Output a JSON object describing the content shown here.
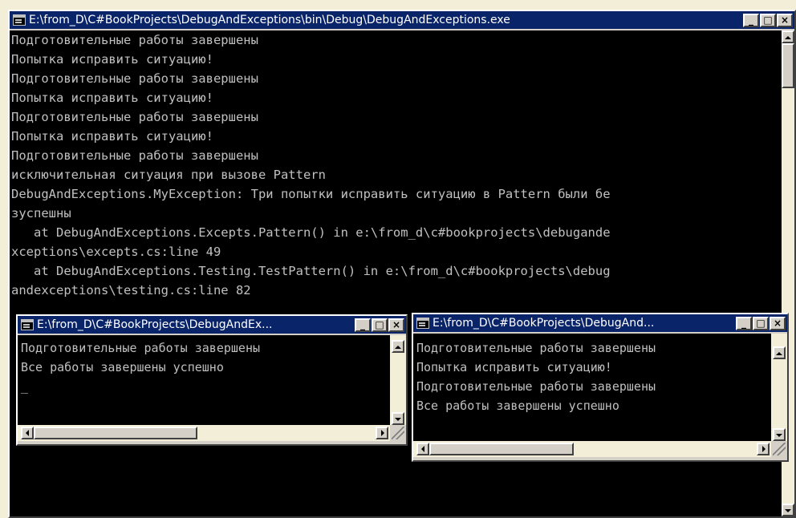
{
  "main_window": {
    "title": "E:\\from_D\\C#BookProjects\\DebugAndExceptions\\bin\\Debug\\DebugAndExceptions.exe",
    "lines": [
      "Подготовительные работы завершены",
      "Попытка исправить ситуацию!",
      "Подготовительные работы завершены",
      "Попытка исправить ситуацию!",
      "Подготовительные работы завершены",
      "Попытка исправить ситуацию!",
      "Подготовительные работы завершены",
      "исключительная ситуация при вызове Pattern",
      "DebugAndExceptions.MyException: Три попытки исправить ситуацию в Pattern были бе",
      "зуспешны",
      "   at DebugAndExceptions.Excepts.Pattern() in e:\\from_d\\c#bookprojects\\debugande",
      "xceptions\\excepts.cs:line 49",
      "   at DebugAndExceptions.Testing.TestPattern() in e:\\from_d\\c#bookprojects\\debug",
      "andexceptions\\testing.cs:line 82"
    ],
    "minimize_label": "_",
    "maximize_label": "□",
    "close_label": "×"
  },
  "window_left": {
    "title": "E:\\from_D\\C#BookProjects\\DebugAndEx...",
    "lines": [
      "Подготовительные работы завершены",
      "Все работы завершены успешно",
      "_"
    ],
    "minimize_label": "_",
    "maximize_label": "□",
    "close_label": "×"
  },
  "window_right": {
    "title": "E:\\from_D\\C#BookProjects\\DebugAnd...",
    "lines": [
      "Подготовительные работы завершены",
      "Попытка исправить ситуацию!",
      "Подготовительные работы завершены",
      "Все работы завершены успешно"
    ],
    "minimize_label": "_",
    "maximize_label": "□",
    "close_label": "×"
  },
  "colors": {
    "title_bar": "#0a246a",
    "console_bg": "#000000",
    "console_text": "#c0c0c0",
    "chrome": "#d4d0c8"
  }
}
